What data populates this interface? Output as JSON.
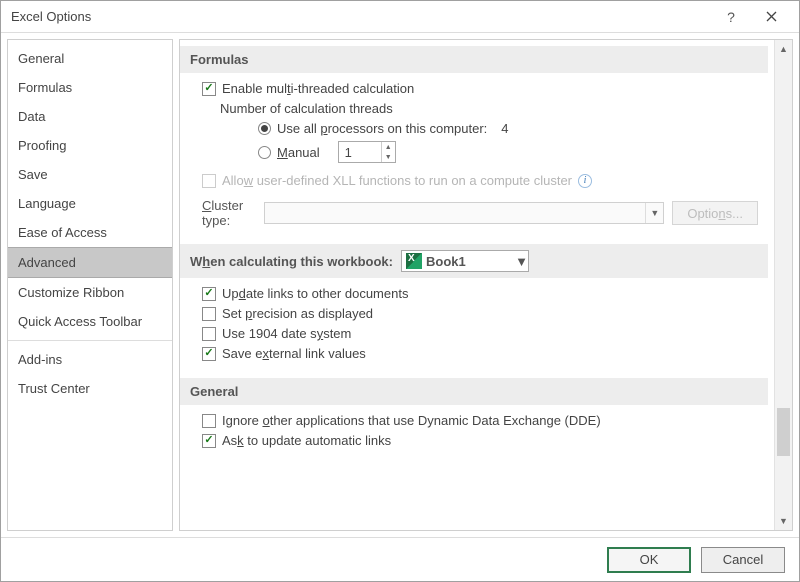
{
  "window": {
    "title": "Excel Options"
  },
  "sidebar": {
    "items": [
      "General",
      "Formulas",
      "Data",
      "Proofing",
      "Save",
      "Language",
      "Ease of Access",
      "Advanced",
      "Customize Ribbon",
      "Quick Access Toolbar",
      "Add-ins",
      "Trust Center"
    ],
    "selected": "Advanced"
  },
  "formulas": {
    "heading": "Formulas",
    "enable_multi": "Enable multi-threaded calculation",
    "threads_label": "Number of calculation threads",
    "use_all": "Use all processors on this computer:",
    "processor_count": "4",
    "manual": "Manual",
    "manual_value": "1",
    "allow_xll": "Allow user-defined XLL functions to run on a compute cluster",
    "cluster_type_label": "Cluster type:",
    "options_btn": "Options..."
  },
  "workbook": {
    "heading": "When calculating this workbook:",
    "book_name": "Book1",
    "update_links": "Update links to other documents",
    "set_precision": "Set precision as displayed",
    "use_1904": "Use 1904 date system",
    "save_external": "Save external link values"
  },
  "general": {
    "heading": "General",
    "ignore_dde": "Ignore other applications that use Dynamic Data Exchange (DDE)",
    "ask_update": "Ask to update automatic links"
  },
  "buttons": {
    "ok": "OK",
    "cancel": "Cancel"
  }
}
